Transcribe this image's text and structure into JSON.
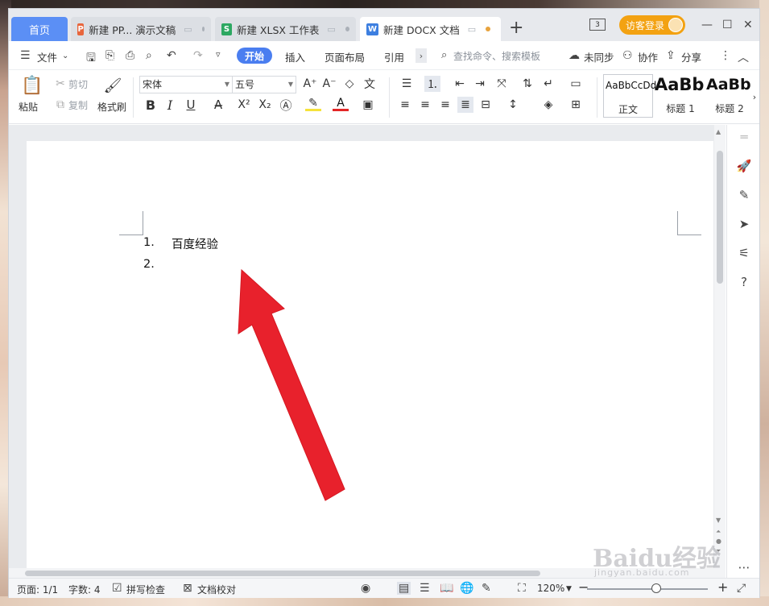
{
  "tabs": {
    "home": "首页",
    "docs": [
      {
        "icon": "P",
        "icon_color": "#e8663d",
        "label": "新建 PP... 演示文稿",
        "active": false
      },
      {
        "icon": "S",
        "icon_color": "#2da862",
        "label": "新建 XLSX 工作表",
        "active": false
      },
      {
        "icon": "W",
        "icon_color": "#3d7fe0",
        "label": "新建 DOCX 文档",
        "active": true
      }
    ],
    "add": "+"
  },
  "titlebar": {
    "page_count": "3",
    "login": "访客登录",
    "minimize": "—",
    "maximize": "☐",
    "close": "✕"
  },
  "menubar": {
    "file": "文件",
    "items": [
      "开始",
      "插入",
      "页面布局",
      "引用"
    ],
    "search": "查找命令、搜索模板",
    "unsynced": "未同步",
    "collab": "协作",
    "share": "分享"
  },
  "ribbon": {
    "paste": "粘贴",
    "cut": "剪切",
    "copy": "复制",
    "format_painter": "格式刷",
    "font_name": "宋体",
    "font_size": "五号",
    "styles": [
      {
        "sample": "AaBbCcDd",
        "name": "正文"
      },
      {
        "sample": "AaBb",
        "name": "标题 1"
      },
      {
        "sample": "AaBb",
        "name": "标题 2"
      }
    ]
  },
  "document": {
    "list": [
      {
        "num": "1.",
        "text": "百度经验"
      },
      {
        "num": "2.",
        "text": ""
      }
    ]
  },
  "statusbar": {
    "page": "页面: 1/1",
    "words": "字数: 4",
    "spellcheck": "拼写检查",
    "proofread": "文档校对",
    "zoom": "120%"
  },
  "watermark": {
    "brand": "Baidu经验",
    "url": "jingyan.baidu.com"
  },
  "colors": {
    "accent": "#4a7ef0",
    "home_tab": "#5b8ff5",
    "login": "#f3a212",
    "arrow": "#e8212c"
  }
}
